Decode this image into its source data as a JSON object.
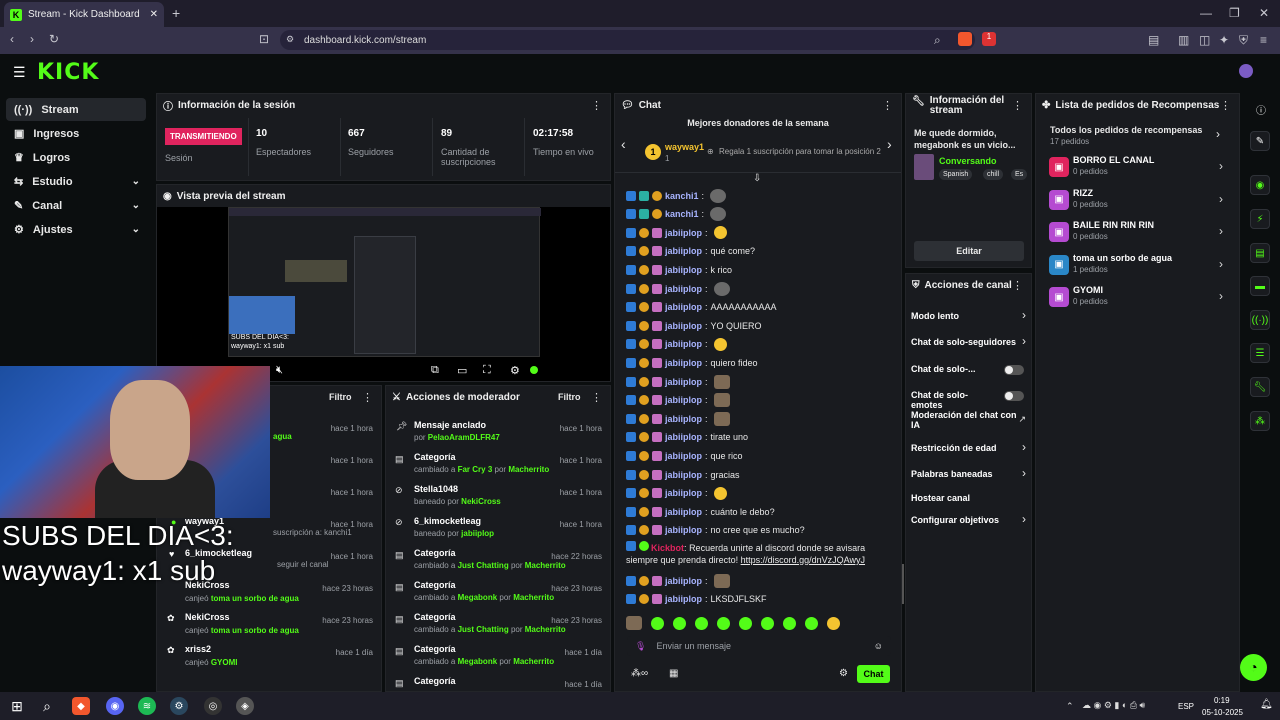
{
  "browser": {
    "tab_title": "Stream - Kick Dashboard",
    "url": "dashboard.kick.com/stream",
    "close": "✕",
    "new_tab": "+",
    "ext_badge_1": "1",
    "ext_badge_2": "1"
  },
  "brand": {
    "logo": "KICK",
    "accent": "#53fc18"
  },
  "sidebar": {
    "items": [
      {
        "label": "Stream"
      },
      {
        "label": "Ingresos"
      },
      {
        "label": "Logros"
      },
      {
        "label": "Estudio"
      },
      {
        "label": "Canal"
      },
      {
        "label": "Ajustes"
      }
    ]
  },
  "session": {
    "title": "Información de la sesión",
    "status": "TRANSMITIENDO",
    "status_label": "Sesión",
    "stats": [
      {
        "value": "10",
        "label": "Espectadores"
      },
      {
        "value": "667",
        "label": "Seguidores"
      },
      {
        "value": "89",
        "label": "Cantidad de suscripciones"
      },
      {
        "value": "02:17:58",
        "label": "Tiempo en vivo"
      }
    ]
  },
  "preview": {
    "title": "Vista previa del stream",
    "mini_text_1": "SUBS DEL DIA<3:",
    "mini_text_2": "wayway1: x1 sub"
  },
  "webcam_overlay": {
    "line1": "SUBS DEL DIA<3:",
    "line2": "wayway1: x1 sub"
  },
  "activity": {
    "filter": "Filtro",
    "items": [
      {
        "name": "",
        "detail": "agua",
        "time": "hace 1 hora"
      },
      {
        "name": "",
        "detail": "",
        "time": "hace 1 hora"
      },
      {
        "name": "",
        "detail": "",
        "time": "hace 1 hora"
      },
      {
        "name": "wayway1",
        "detail": "suscripción a: kanchi1",
        "time": "hace 1 hora"
      },
      {
        "name": "6_kimocketleag",
        "detail": "seguir el canal",
        "time": "hace 1 hora"
      },
      {
        "name": "NekiCross",
        "verb": "canjeó",
        "detail": "toma un sorbo de agua",
        "time": "hace 23 horas"
      },
      {
        "name": "NekiCross",
        "verb": "canjeó",
        "detail": "toma un sorbo de agua",
        "time": "hace 23 horas"
      },
      {
        "name": "xriss2",
        "verb": "canjeó",
        "detail": "GYOMI",
        "time": "hace 1 día"
      }
    ]
  },
  "modactions": {
    "title": "Acciones de moderador",
    "filter": "Filtro",
    "items": [
      {
        "title": "Mensaje anclado",
        "pre": "por",
        "target": "PelaoAramDLFR47",
        "mid": "",
        "actor": "",
        "time": "hace 1 hora"
      },
      {
        "title": "Categoría",
        "pre": "cambiado a",
        "target": "Far Cry 3",
        "mid": "por",
        "actor": "Macherrito",
        "time": "hace 1 hora"
      },
      {
        "title": "Stella1048",
        "pre": "baneado por",
        "target": "NekiCross",
        "mid": "",
        "actor": "",
        "time": "hace 1 hora"
      },
      {
        "title": "6_kimocketleag",
        "pre": "baneado por",
        "target": "jabiiplop",
        "mid": "",
        "actor": "",
        "time": "hace 1 hora"
      },
      {
        "title": "Categoría",
        "pre": "cambiado a",
        "target": "Just Chatting",
        "mid": "por",
        "actor": "Macherrito",
        "time": "hace 22 horas"
      },
      {
        "title": "Categoría",
        "pre": "cambiado a",
        "target": "Megabonk",
        "mid": "por",
        "actor": "Macherrito",
        "time": "hace 23 horas"
      },
      {
        "title": "Categoría",
        "pre": "cambiado a",
        "target": "Just Chatting",
        "mid": "por",
        "actor": "Macherrito",
        "time": "hace 23 horas"
      },
      {
        "title": "Categoría",
        "pre": "cambiado a",
        "target": "Megabonk",
        "mid": "por",
        "actor": "Macherrito",
        "time": "hace 1 día"
      },
      {
        "title": "Categoría",
        "pre": "",
        "target": "",
        "mid": "",
        "actor": "",
        "time": "hace 1 día"
      }
    ]
  },
  "chat": {
    "title": "Chat",
    "donors_title": "Mejores donadores de la semana",
    "top_donor": "wayway1",
    "top_rank": "1",
    "top_count": "1",
    "gift_hint": "Regala 1 suscripción para tomar la posición 2",
    "messages": [
      {
        "user": "kanchi1",
        "text": "",
        "emote": "g"
      },
      {
        "user": "kanchi1",
        "text": "",
        "emote": "g"
      },
      {
        "user": "jabiiplop",
        "text": "",
        "emote": "y"
      },
      {
        "user": "jabiiplop",
        "text": "qué come?",
        "emote": ""
      },
      {
        "user": "jabiiplop",
        "text": "k rico",
        "emote": ""
      },
      {
        "user": "jabiiplop",
        "text": "",
        "emote": "g"
      },
      {
        "user": "jabiiplop",
        "text": "AAAAAAAAAAA",
        "emote": ""
      },
      {
        "user": "jabiiplop",
        "text": "YO QUIERO",
        "emote": ""
      },
      {
        "user": "jabiiplop",
        "text": "",
        "emote": "y"
      },
      {
        "user": "jabiiplop",
        "text": "quiero fideo",
        "emote": ""
      },
      {
        "user": "jabiiplop",
        "text": "",
        "emote": "b"
      },
      {
        "user": "jabiiplop",
        "text": "",
        "emote": "b"
      },
      {
        "user": "jabiiplop",
        "text": "",
        "emote": "b"
      },
      {
        "user": "jabiiplop",
        "text": "tirate uno",
        "emote": ""
      },
      {
        "user": "jabiiplop",
        "text": "que rico",
        "emote": ""
      },
      {
        "user": "jabiiplop",
        "text": "gracias",
        "emote": ""
      },
      {
        "user": "jabiiplop",
        "text": "",
        "emote": "y"
      },
      {
        "user": "jabiiplop",
        "text": "cuánto le debo?",
        "emote": ""
      },
      {
        "user": "jabiiplop",
        "text": "no cree que es mucho?",
        "emote": ""
      }
    ],
    "bot_user": "Kickbot",
    "bot_text": "Recuerda unirte al discord donde se avisara siempre",
    "bot_text2": "que prenda directo!",
    "bot_link": "https://discord.gg/dnVzJQAwyJ",
    "last_messages": [
      {
        "user": "jabiiplop",
        "text": "",
        "emote": "b"
      },
      {
        "user": "jabiiplop",
        "text": "LKSDJFLSKF",
        "emote": ""
      }
    ],
    "input_placeholder": "Enviar un mensaje",
    "send_label": "Chat"
  },
  "stream_info": {
    "title": "Información del stream",
    "stream_title": "Me quede dormido, megabonk es un vicio...",
    "category": "Conversando",
    "tags": [
      "Spanish",
      "chill",
      "Es"
    ],
    "edit_label": "Editar"
  },
  "channel_actions": {
    "title": "Acciones de canal",
    "items": [
      {
        "label": "Modo lento",
        "control": "chevron"
      },
      {
        "label": "Chat de solo-seguidores",
        "control": "chevron"
      },
      {
        "label": "Chat de solo-...",
        "control": "toggle"
      },
      {
        "label": "Chat de solo-emotes",
        "control": "toggle"
      },
      {
        "label": "Moderación del chat con IA",
        "control": "external"
      },
      {
        "label": "Restricción de edad",
        "control": "chevron"
      },
      {
        "label": "Palabras baneadas",
        "control": "chevron"
      },
      {
        "label": "Hostear canal",
        "control": "none"
      },
      {
        "label": "Configurar objetivos",
        "control": "chevron"
      }
    ]
  },
  "rewards": {
    "title": "Lista de pedidos de Recompensas",
    "all_label": "Todos los pedidos de recompensas",
    "all_count": "17 pedidos",
    "items": [
      {
        "name": "BORRO EL CANAL",
        "count": "0 pedidos",
        "color": "#e0245e"
      },
      {
        "name": "RIZZ",
        "count": "0 pedidos",
        "color": "#b54bd1"
      },
      {
        "name": "BAILE RIN RIN RIN",
        "count": "0 pedidos",
        "color": "#b54bd1"
      },
      {
        "name": "toma un sorbo de agua",
        "count": "1 pedidos",
        "color": "#2a87c7"
      },
      {
        "name": "GYOMI",
        "count": "0 pedidos",
        "color": "#b54bd1"
      }
    ]
  },
  "taskbar": {
    "lang": "ESP",
    "time": "0:19",
    "date": "05-10-2025"
  }
}
